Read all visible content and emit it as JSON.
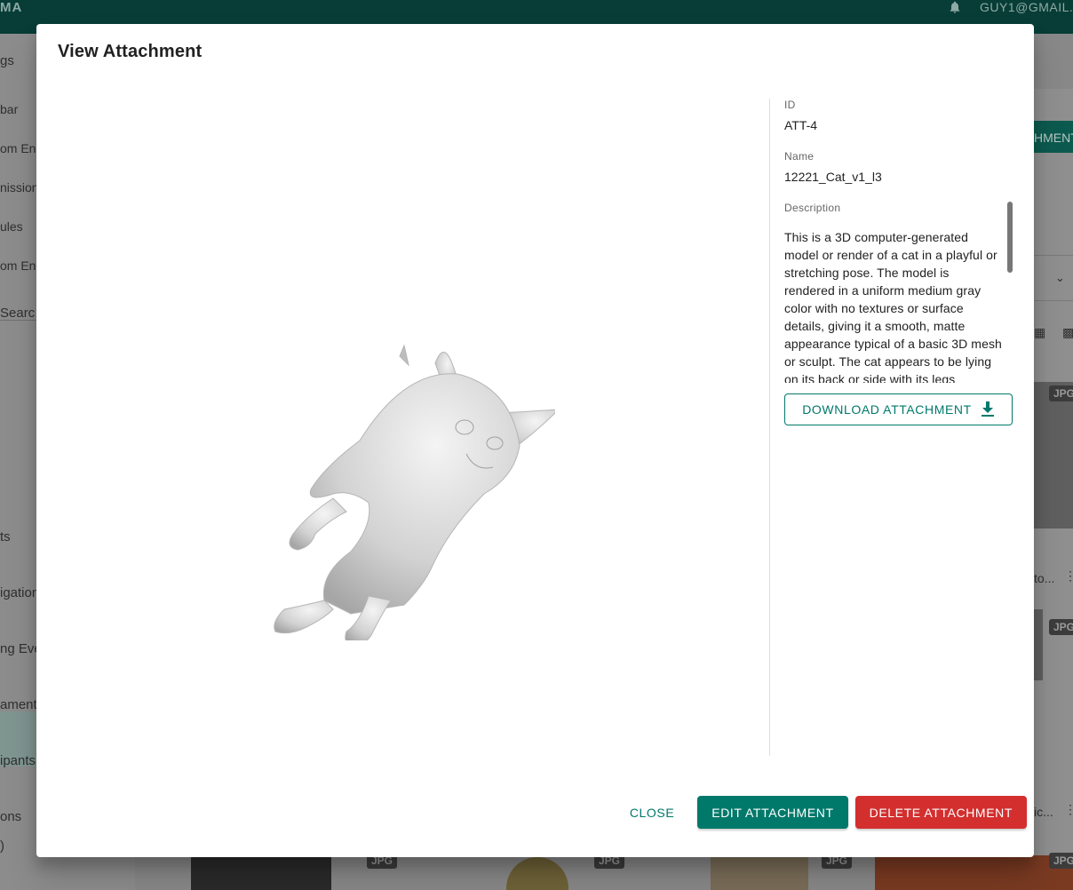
{
  "app": {
    "title_fragment": "MA",
    "user_email": "GUY1@GMAIL.C"
  },
  "sidebar": {
    "items": [
      {
        "label": "gs"
      },
      {
        "label": "bar"
      },
      {
        "label": "om En"
      },
      {
        "label": "nission"
      },
      {
        "label": "ules"
      },
      {
        "label": "om En"
      },
      {
        "label": " Searc"
      },
      {
        "label": "ts"
      },
      {
        "label": "igation"
      },
      {
        "label": "ng Eve"
      },
      {
        "label": "ament"
      },
      {
        "label": "ipants"
      },
      {
        "label": "ons"
      },
      {
        "label": ")"
      }
    ]
  },
  "background_right": {
    "button_fragment": "HMENT",
    "card_1_title": "to...",
    "card_2_title": "ic...",
    "badge": "JPG"
  },
  "dialog": {
    "title": "View Attachment",
    "fields": {
      "id_label": "ID",
      "id_value": "ATT-4",
      "name_label": "Name",
      "name_value": "12221_Cat_v1_l3",
      "description_label": "Description",
      "description_value": "This is a 3D computer-generated model or render of a cat in a playful or stretching pose. The model is rendered in a uniform medium gray color with no textures or surface details, giving it a smooth, matte appearance typical of a basic 3D mesh or sculpt. The cat appears to be lying on its back or side with its legs"
    },
    "download_label": "DOWNLOAD ATTACHMENT",
    "actions": {
      "close": "CLOSE",
      "edit": "EDIT ATTACHMENT",
      "delete": "DELETE ATTACHMENT"
    }
  },
  "colors": {
    "primary": "#00796b",
    "danger": "#d32f2f",
    "app_bar": "#073d36"
  }
}
